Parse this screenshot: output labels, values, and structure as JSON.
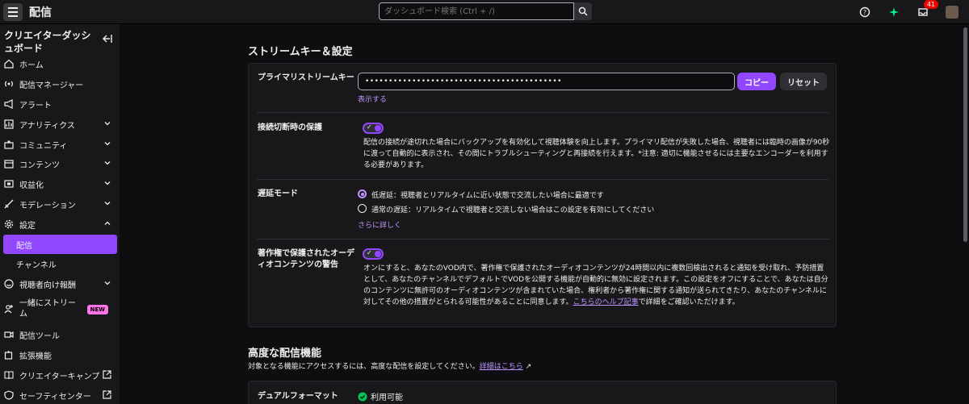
{
  "topbar": {
    "title": "配信",
    "search_placeholder": "ダッシュボード検索 (Ctrl + /)",
    "notification_count": "41"
  },
  "sidebar": {
    "title": "クリエイターダッシュボード",
    "items": [
      {
        "label": "ホーム",
        "icon": "home-icon"
      },
      {
        "label": "配信マネージャー",
        "icon": "broadcast-icon"
      },
      {
        "label": "アラート",
        "icon": "megaphone-icon"
      },
      {
        "label": "アナリティクス",
        "icon": "chart-icon"
      },
      {
        "label": "コミュニティ",
        "icon": "community-icon"
      },
      {
        "label": "コンテンツ",
        "icon": "folder-icon"
      },
      {
        "label": "収益化",
        "icon": "monetize-icon"
      },
      {
        "label": "モデレーション",
        "icon": "sword-icon"
      },
      {
        "label": "設定",
        "icon": "gear-icon"
      },
      {
        "label": "配信"
      },
      {
        "label": "チャンネル"
      },
      {
        "label": "視聴者向け報酬",
        "icon": "smile-icon"
      },
      {
        "label": "一緒にストリーム",
        "icon": "add-user-icon",
        "badge": "NEW"
      },
      {
        "label": "配信ツール",
        "icon": "camera-icon"
      },
      {
        "label": "拡張機能",
        "icon": "puzzle-icon"
      },
      {
        "label": "クリエイターキャンプ",
        "icon": "book-icon"
      },
      {
        "label": "セーフティセンター",
        "icon": "shield-icon"
      }
    ]
  },
  "stream_key": {
    "heading": "ストリームキー＆設定",
    "primary_key_label": "プライマリストリームキー",
    "key_value": "••••••••••••••••••••••••••••••••••••••••••",
    "copy_label": "コピー",
    "reset_label": "リセット",
    "show_label": "表示する",
    "disconnect_label": "接続切断時の保護",
    "disconnect_desc": "配信の接続が途切れた場合にバックアップを有効化して視聴体験を向上します。プライマリ配信が失敗した場合、視聴者には臨時の画像が90秒に渡って自動的に表示され、その間にトラブルシューティングと再接続を行えます。*注意: 適切に機能させるには主要なエンコーダーを利用する必要があります。",
    "latency_label": "遅延モード",
    "latency_low": "低遅延：視聴者とリアルタイムに近い状態で交流したい場合に最適です",
    "latency_normal": "通常の遅延：リアルタイムで視聴者と交流しない場合はこの設定を有効にしてください",
    "learn_more": "さらに詳しく",
    "copyright_label": "著作権で保護されたオーディオコンテンツの警告",
    "copyright_desc_1": "オンにすると、あなたのVOD内で、著作権で保護されたオーディオコンテンツが24時間以内に複数回検出されると通知を受け取れ、予防措置として、あなたのチャンネルでデフォルトでVODを公開する機能が自動的に無効に設定されます。この設定をオフにすることで、あなたは自分のコンテンツに無許可のオーディオコンテンツが含まれていた場合、権利者から著作権に関する通知が送られてきたり、あなたのチャンネルに対してその他の措置がとられる可能性があることに同意します。",
    "copyright_help_link": "こちらのヘルプ記事",
    "copyright_desc_2": "で詳細をご確認いただけます。"
  },
  "advanced": {
    "heading": "高度な配信機能",
    "subtext": "対象となる機能にアクセスするには、高度な配信を設定してください。",
    "details_link": "詳細はこちら",
    "dual_format_label": "デュアルフォーマット",
    "dual_format_status": "利用可能"
  },
  "colors": {
    "accent": "#9147ff",
    "link": "#bf94ff",
    "available": "#00c853"
  }
}
